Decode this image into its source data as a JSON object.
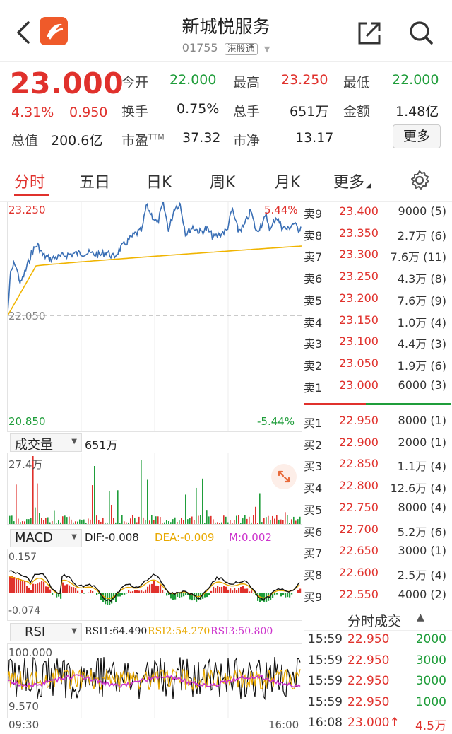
{
  "header": {
    "title": "新城悦服务",
    "code": "01755",
    "market_tag": "港股通"
  },
  "quote": {
    "price": "23.000",
    "change_pct": "4.31%",
    "change": "0.950",
    "open_label": "今开",
    "open": "22.000",
    "high_label": "最高",
    "high": "23.250",
    "low_label": "最低",
    "low": "22.000",
    "turnover_label": "换手",
    "turnover": "0.75%",
    "volume_label": "总手",
    "volume": "651万",
    "amount_label": "金额",
    "amount": "1.48亿",
    "mktcap_label": "总值",
    "mktcap": "200.6亿",
    "pe_label": "市盈",
    "pe_sup": "TTM",
    "pe": "37.32",
    "pb_label": "市净",
    "pb": "13.17",
    "more_label": "更多"
  },
  "tabs": [
    "分时",
    "五日",
    "日K",
    "周K",
    "月K",
    "更多"
  ],
  "main_chart": {
    "y_top": "23.250",
    "y_mid": "22.050",
    "y_bottom": "20.850",
    "pct_top": "5.44%",
    "pct_bottom": "-5.44%"
  },
  "volume_panel": {
    "selector": "成交量",
    "total": "651万",
    "max_label": "27.4万"
  },
  "macd_panel": {
    "selector": "MACD",
    "dif": "DIF:-0.008",
    "dea": "DEA:-0.009",
    "m": "M:0.002",
    "top": "0.157",
    "bottom": "-0.074"
  },
  "rsi_panel": {
    "selector": "RSI",
    "rsi1": "RSI1:64.490",
    "rsi2": "RSI2:54.270",
    "rsi3": "RSI3:50.800",
    "top": "100.000",
    "bottom": "9.570",
    "time_start": "09:30",
    "time_end": "16:00"
  },
  "order_book": {
    "asks": [
      {
        "side": "卖9",
        "price": "23.400",
        "vol": "9000 (5)"
      },
      {
        "side": "卖8",
        "price": "23.350",
        "vol": "2.7万 (6)"
      },
      {
        "side": "卖7",
        "price": "23.300",
        "vol": "7.6万 (11)"
      },
      {
        "side": "卖6",
        "price": "23.250",
        "vol": "4.3万 (8)"
      },
      {
        "side": "卖5",
        "price": "23.200",
        "vol": "7.6万 (9)"
      },
      {
        "side": "卖4",
        "price": "23.150",
        "vol": "1.0万 (4)"
      },
      {
        "side": "卖3",
        "price": "23.100",
        "vol": "4.4万 (3)"
      },
      {
        "side": "卖2",
        "price": "23.050",
        "vol": "1.9万 (6)"
      },
      {
        "side": "卖1",
        "price": "23.000",
        "vol": "6000 (3)"
      }
    ],
    "bids": [
      {
        "side": "买1",
        "price": "22.950",
        "vol": "8000 (1)"
      },
      {
        "side": "买2",
        "price": "22.900",
        "vol": "2000 (1)"
      },
      {
        "side": "买3",
        "price": "22.850",
        "vol": "1.1万 (4)"
      },
      {
        "side": "买4",
        "price": "22.800",
        "vol": "12.6万 (4)"
      },
      {
        "side": "买5",
        "price": "22.750",
        "vol": "8000 (4)"
      },
      {
        "side": "买6",
        "price": "22.700",
        "vol": "5.2万 (6)"
      },
      {
        "side": "买7",
        "price": "22.650",
        "vol": "3000 (1)"
      },
      {
        "side": "买8",
        "price": "22.600",
        "vol": "2.5万 (4)"
      },
      {
        "side": "买9",
        "price": "22.550",
        "vol": "4000 (2)"
      }
    ]
  },
  "ticks": {
    "title": "分时成交",
    "rows": [
      {
        "time": "15:59",
        "price": "22.950",
        "vol": "2000",
        "color": "green"
      },
      {
        "time": "15:59",
        "price": "22.950",
        "vol": "3000",
        "color": "green"
      },
      {
        "time": "15:59",
        "price": "22.950",
        "vol": "3000",
        "color": "green"
      },
      {
        "time": "15:59",
        "price": "22.950",
        "vol": "1000",
        "color": "green"
      },
      {
        "time": "16:08",
        "price": "23.000↑",
        "vol": "4.5万",
        "color": "red"
      }
    ]
  },
  "colors": {
    "up": "#e0312c",
    "down": "#1f9d3a",
    "price_line": "#3a6fb5",
    "avg_line": "#f0b400",
    "dea": "#e8a800",
    "m": "#cc33cc"
  }
}
